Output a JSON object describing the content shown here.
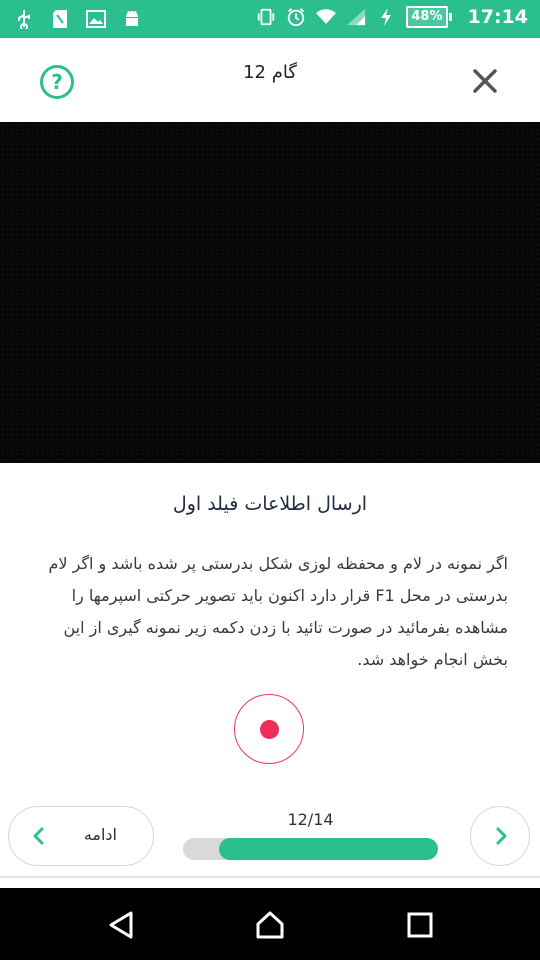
{
  "status_bar": {
    "icons": [
      "usb-icon",
      "sd-card-icon",
      "image-icon",
      "android-icon",
      "vibrate-icon",
      "alarm-icon",
      "wifi-icon",
      "signal-icon",
      "charging-icon"
    ],
    "battery": "48%",
    "time": "17:14"
  },
  "header": {
    "title": "گام 12",
    "help_icon": "?",
    "close_icon": "close-icon"
  },
  "content": {
    "section_title": "ارسال اطلاعات فیلد اول",
    "description": "اگر نمونه در لام و محفظه لوزی شکل بدرستی پر شده باشد و اگر لام بدرستی در محل F1 قرار دارد اکنون باید تصویر حرکتی اسپرمها را مشاهده بفرمائید در صورت تائید با زدن دکمه زیر نمونه گیری از این بخش انجام خواهد شد."
  },
  "footer": {
    "continue_label": "ادامه",
    "progress_text": "12/14",
    "progress_fraction": 0.857
  },
  "colors": {
    "accent": "#2bbf8f",
    "record": "#ee2e58"
  }
}
